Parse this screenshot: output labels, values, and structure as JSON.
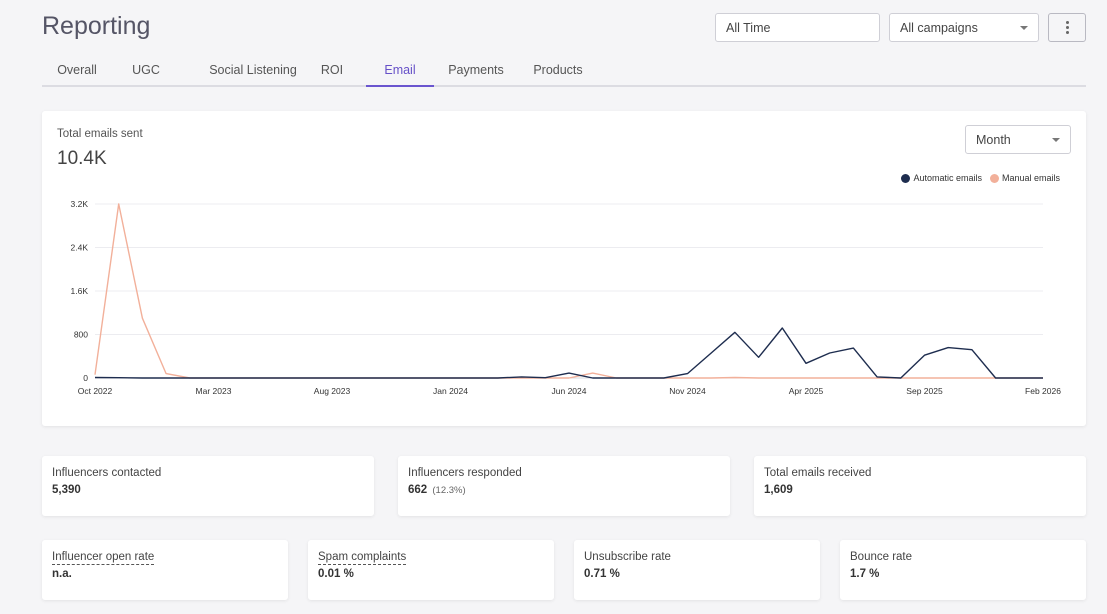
{
  "header": {
    "title": "Reporting",
    "date_filter": "All Time",
    "campaign_filter": "All campaigns",
    "more_icon": "more-vertical-icon"
  },
  "tabs": [
    {
      "label": "Overall"
    },
    {
      "label": "UGC"
    },
    {
      "label": "Social Listening"
    },
    {
      "label": "ROI"
    },
    {
      "label": "Email",
      "active": true
    },
    {
      "label": "Payments"
    },
    {
      "label": "Products"
    }
  ],
  "chart_card": {
    "label": "Total emails sent",
    "total": "10.4K",
    "period": "Month"
  },
  "chart_data": {
    "type": "line",
    "y_ticks": [
      "0",
      "800",
      "1.6K",
      "2.4K",
      "3.2K"
    ],
    "ylim": [
      0,
      3200
    ],
    "x_tick_labels": [
      "Oct 2022",
      "Mar 2023",
      "Aug 2023",
      "Jan 2024",
      "Jun 2024",
      "Nov 2024",
      "Apr 2025",
      "Sep 2025",
      "Feb 2026"
    ],
    "grid": true,
    "legend_position": "top-right",
    "months": [
      "2022-10",
      "2022-11",
      "2022-12",
      "2023-01",
      "2023-02",
      "2023-03",
      "2023-04",
      "2023-05",
      "2023-06",
      "2023-07",
      "2023-08",
      "2023-09",
      "2023-10",
      "2023-11",
      "2023-12",
      "2024-01",
      "2024-02",
      "2024-03",
      "2024-04",
      "2024-05",
      "2024-06",
      "2024-07",
      "2024-08",
      "2024-09",
      "2024-10",
      "2024-11",
      "2024-12",
      "2025-01",
      "2025-02",
      "2025-03",
      "2025-04",
      "2025-05",
      "2025-06",
      "2025-07",
      "2025-08",
      "2025-09",
      "2025-10",
      "2025-11",
      "2025-12",
      "2026-01",
      "2026-02"
    ],
    "series": [
      {
        "name": "Automatic emails",
        "color": "#1e2d4f",
        "values": [
          10,
          5,
          0,
          0,
          0,
          0,
          0,
          0,
          0,
          0,
          0,
          0,
          0,
          0,
          0,
          0,
          0,
          0,
          20,
          5,
          90,
          0,
          0,
          0,
          0,
          80,
          460,
          840,
          380,
          920,
          270,
          460,
          550,
          20,
          0,
          420,
          560,
          520,
          0,
          0,
          0
        ]
      },
      {
        "name": "Manual emails",
        "color": "#f2b09a",
        "values": [
          60,
          3200,
          1100,
          80,
          0,
          0,
          0,
          0,
          0,
          0,
          0,
          0,
          0,
          0,
          0,
          0,
          0,
          0,
          0,
          0,
          0,
          90,
          0,
          0,
          0,
          0,
          0,
          10,
          0,
          0,
          0,
          0,
          0,
          0,
          0,
          0,
          0,
          0,
          0,
          0,
          0
        ]
      }
    ]
  },
  "stats_row1": [
    {
      "label": "Influencers contacted",
      "value": "5,390",
      "sub": ""
    },
    {
      "label": "Influencers responded",
      "value": "662",
      "sub": "(12.3%)"
    },
    {
      "label": "Total emails received",
      "value": "1,609",
      "sub": ""
    }
  ],
  "stats_row2": [
    {
      "label": "Influencer open rate",
      "value": "n.a."
    },
    {
      "label": "Spam complaints",
      "value": "0.01 %"
    },
    {
      "label": "Unsubscribe rate",
      "value": "0.71 %"
    },
    {
      "label": "Bounce rate",
      "value": "1.7 %"
    }
  ]
}
